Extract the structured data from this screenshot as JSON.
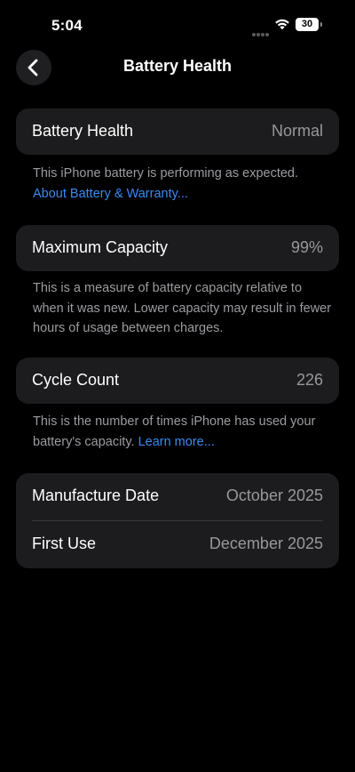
{
  "status_bar": {
    "time": "5:04",
    "battery_level": "30",
    "icons": [
      "cellular-dots-icon",
      "wifi-icon",
      "battery-icon"
    ]
  },
  "nav": {
    "title": "Battery Health",
    "back_icon": "chevron-left-icon"
  },
  "battery_health": {
    "label": "Battery Health",
    "value": "Normal",
    "footnote": "This iPhone battery is performing as expected.",
    "link": "About Battery & Warranty..."
  },
  "maximum_capacity": {
    "label": "Maximum Capacity",
    "value": "99%",
    "footnote": "This is a measure of battery capacity relative to when it was new. Lower capacity may result in fewer hours of usage between charges."
  },
  "cycle_count": {
    "label": "Cycle Count",
    "value": "226",
    "footnote": "This is the number of times iPhone has used your battery's capacity.",
    "link": "Learn more..."
  },
  "dates": {
    "manufacture_label": "Manufacture Date",
    "manufacture_value": "October 2025",
    "first_use_label": "First Use",
    "first_use_value": "December 2025"
  },
  "colors": {
    "background": "#000000",
    "card": "#1c1c1e",
    "secondary_text": "#98989d",
    "link": "#3a8bf0"
  }
}
